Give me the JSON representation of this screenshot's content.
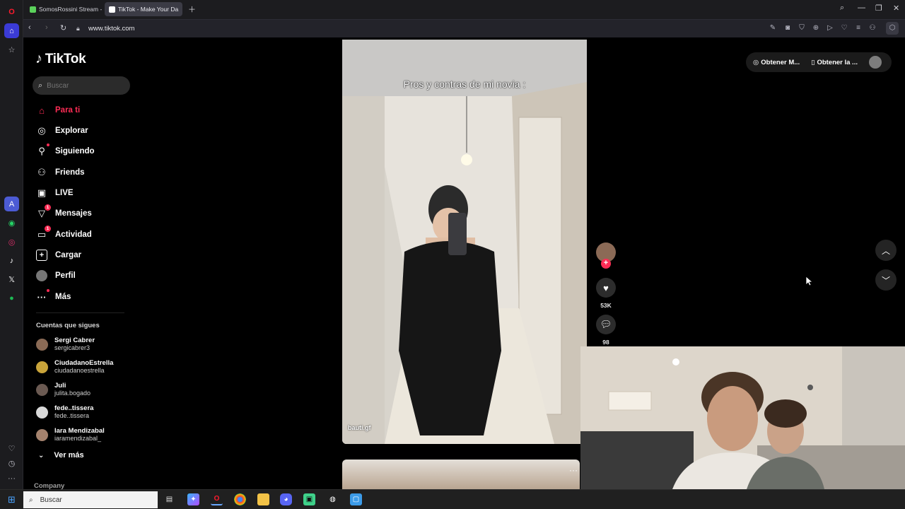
{
  "browser": {
    "tabs": [
      {
        "title": "SomosRossini Stream - W",
        "favicon_color": "#5bd15b"
      },
      {
        "title": "TikTok - Make Your Da",
        "favicon_color": "#ffffff"
      }
    ],
    "url": "www.tiktok.com"
  },
  "tiktok": {
    "brand": "TikTok",
    "search_placeholder": "Buscar",
    "nav": [
      {
        "label": "Para ti",
        "icon": "home-icon",
        "active": true
      },
      {
        "label": "Explorar",
        "icon": "compass-icon"
      },
      {
        "label": "Siguiendo",
        "icon": "following-icon"
      },
      {
        "label": "Friends",
        "icon": "friends-icon"
      },
      {
        "label": "LIVE",
        "icon": "live-icon"
      },
      {
        "label": "Mensajes",
        "icon": "messages-icon",
        "badge": "1"
      },
      {
        "label": "Actividad",
        "icon": "activity-icon",
        "badge": "1"
      },
      {
        "label": "Cargar",
        "icon": "upload-icon"
      },
      {
        "label": "Perfil",
        "icon": "profile-icon"
      },
      {
        "label": "Más",
        "icon": "more-icon"
      }
    ],
    "following_title": "Cuentas que sigues",
    "following": [
      {
        "name": "Sergi Cabrer",
        "handle": "sergicabrer3",
        "avatar_color": "#8a6a55"
      },
      {
        "name": "CiudadanoEstrella",
        "handle": "ciudadanoestrella",
        "avatar_color": "#c9a43a"
      },
      {
        "name": "Juli",
        "handle": "julita.bogado",
        "avatar_color": "#6b5a52"
      },
      {
        "name": "fede..tissera",
        "handle": "fede..tissera",
        "avatar_color": "#d9d9d9"
      },
      {
        "name": "Iara Mendizabal",
        "handle": "iaramendizabal_",
        "avatar_color": "#a5836e"
      }
    ],
    "see_more": "Ver más",
    "company": "Company",
    "video": {
      "caption": "Pros y contras de mi novia :",
      "author": "bauti.gf",
      "likes": "53K",
      "comments": "98"
    },
    "top_actions": [
      "Obtener M...",
      "Obtener la ..."
    ]
  },
  "taskbar": {
    "search_placeholder": "Buscar"
  }
}
